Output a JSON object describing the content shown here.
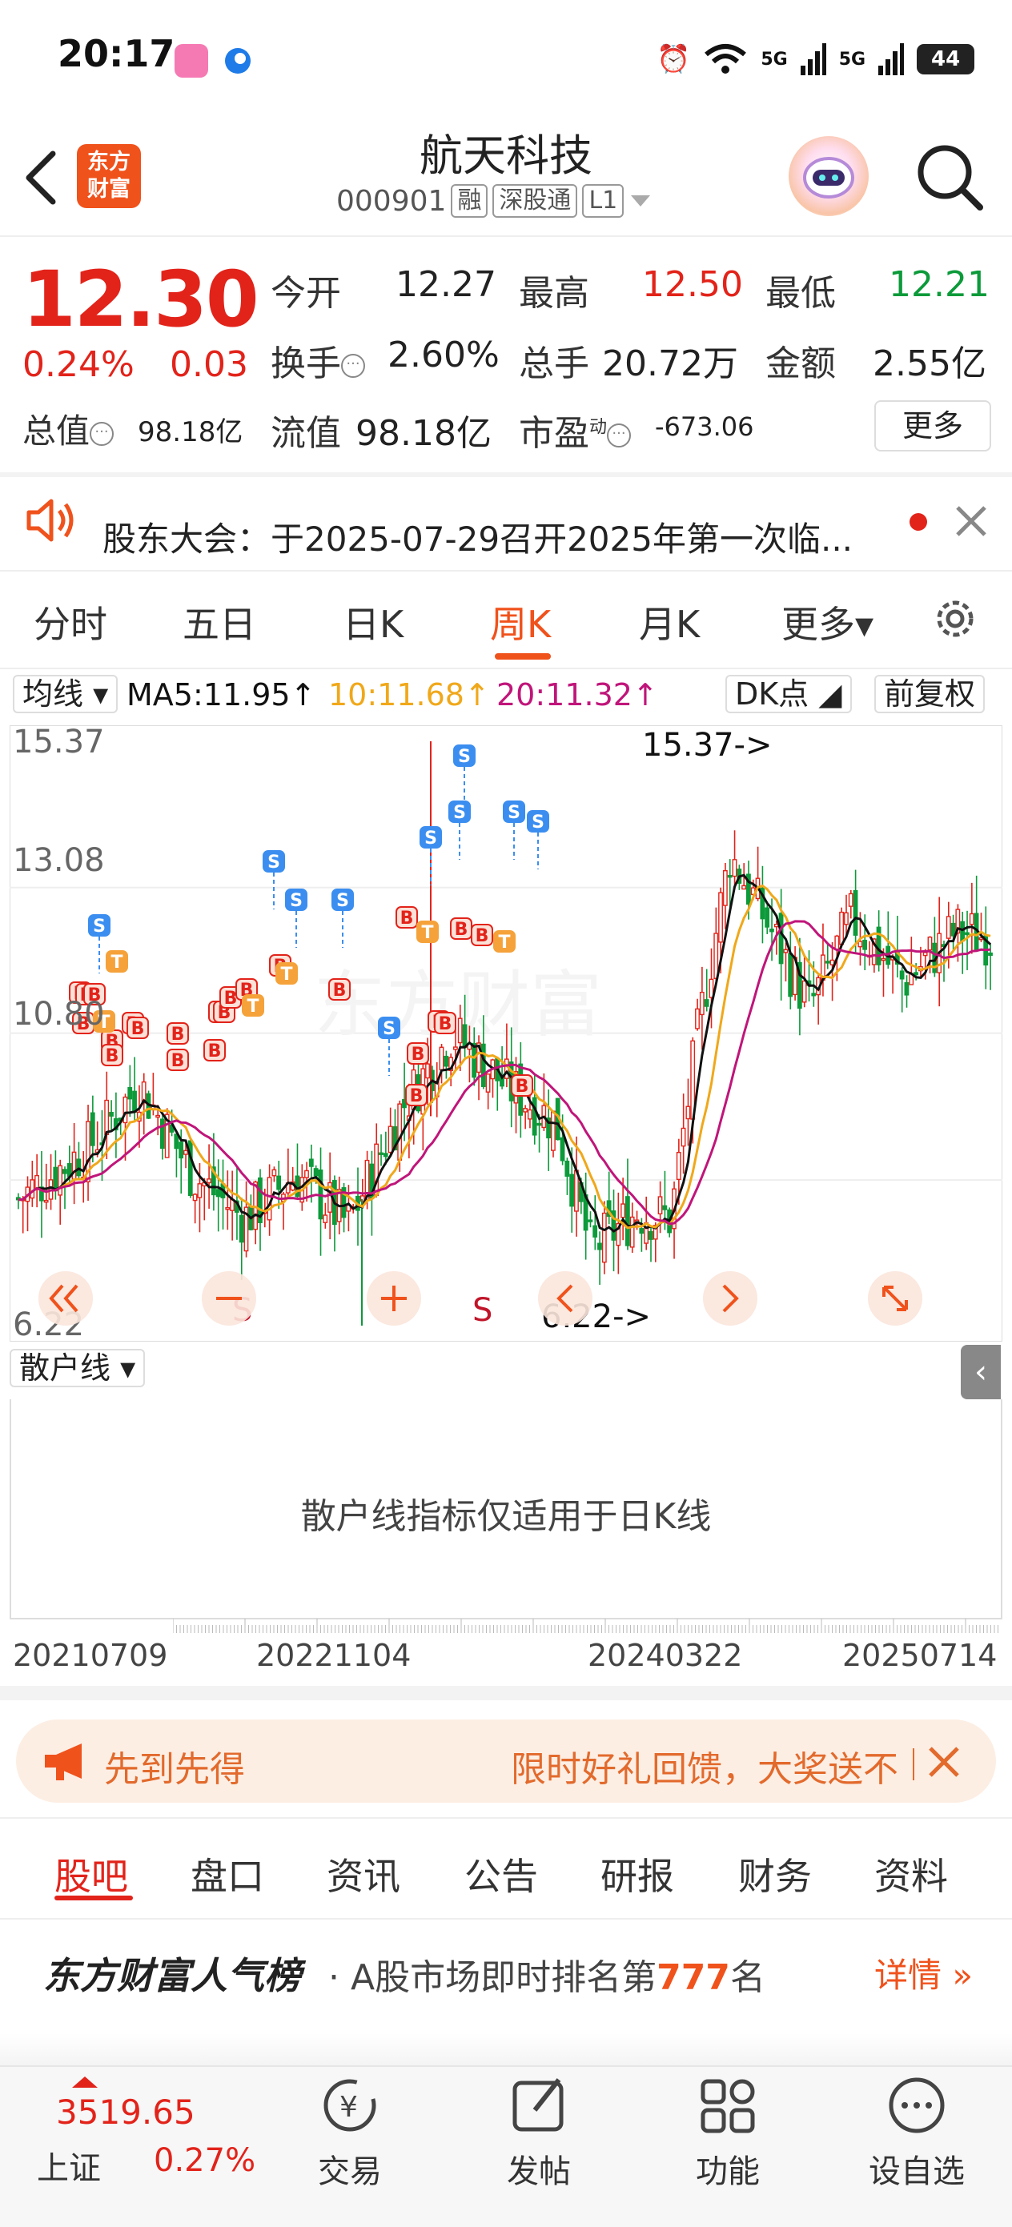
{
  "status_bar": {
    "time": "20:17",
    "network_1": "5G",
    "network_2": "5G",
    "battery": "44"
  },
  "header": {
    "title": "航天科技",
    "code": "000901",
    "tags": [
      "融",
      "深股通",
      "L1"
    ],
    "logo_line1": "东方",
    "logo_line2": "财富"
  },
  "quote": {
    "price": "12.30",
    "pct_change": "0.24%",
    "change": "0.03",
    "open_label": "今开",
    "open": "12.27",
    "high_label": "最高",
    "high": "12.50",
    "low_label": "最低",
    "low": "12.21",
    "turnover_label": "换手",
    "turnover": "2.60%",
    "volume_label": "总手",
    "volume": "20.72万",
    "amount_label": "金额",
    "amount": "2.55亿",
    "mktcap_label": "总值",
    "mktcap": "98.18亿",
    "float_label": "流值",
    "float_cap": "98.18亿",
    "pe_label": "市盈",
    "pe_sup": "动",
    "pe": "-673.06",
    "more_label": "更多"
  },
  "notice": {
    "text": "股东大会：于2025-07-29召开2025年第一次临..."
  },
  "period_tabs": [
    "分时",
    "五日",
    "日K",
    "周K",
    "月K",
    "更多▾"
  ],
  "ma_bar": {
    "indicator": "均线",
    "ma5": "MA5:11.95↑",
    "ma10": "10:11.68↑",
    "ma20": "20:11.32↑",
    "dk": "DK点",
    "adjust": "前复权"
  },
  "colors": {
    "up": "#e2231a",
    "down": "#0c9a3a",
    "ma5": "#111111",
    "ma10": "#f0a81a",
    "ma20": "#c0157a",
    "accent": "#f0521c"
  },
  "chart_data": {
    "type": "candlestick",
    "ylim": [
      6.22,
      15.37
    ],
    "y_ticks": [
      "15.37",
      "13.08",
      "10.80",
      "6.22"
    ],
    "max_label": "15.37->",
    "min_label": "6.22->",
    "x_ticks": [
      "20210709",
      "20221104",
      "20240322",
      "20250714"
    ],
    "s_markers": [
      "S",
      "S"
    ]
  },
  "indicator": {
    "name": "散户线",
    "message": "散户线指标仅适用于日K线"
  },
  "promo": {
    "left": "先到先得",
    "right": "限时好礼回馈，大奖送不"
  },
  "section_tabs": [
    "股吧",
    "盘口",
    "资讯",
    "公告",
    "研报",
    "财务",
    "资料"
  ],
  "rank": {
    "title": "东方财富人气榜",
    "text_prefix": "· A股市场即时排名第",
    "rank": "777",
    "text_suffix": "名",
    "detail": "详情"
  },
  "bottom_nav": {
    "index_value": "3519.65",
    "index_name": "上证",
    "index_pct": "0.27%",
    "items": [
      "交易",
      "发帖",
      "功能",
      "设自选"
    ]
  }
}
